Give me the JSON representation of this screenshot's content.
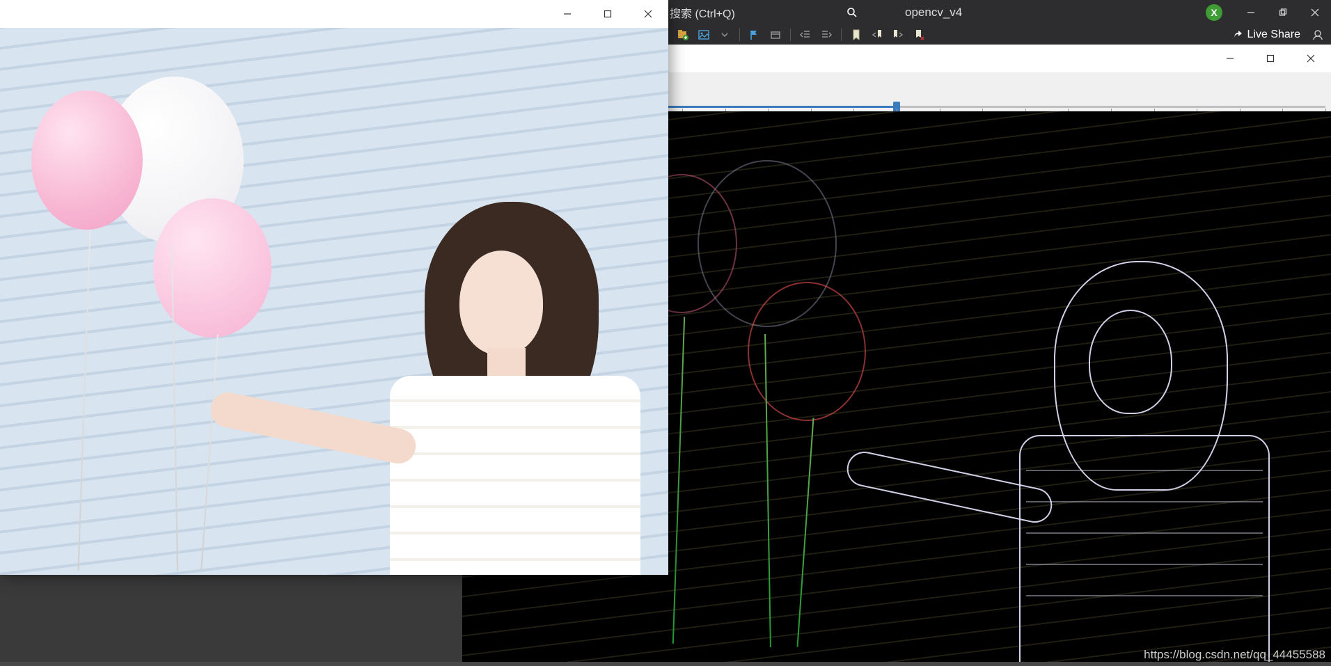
{
  "vs": {
    "search_hint": "搜索 (Ctrl+Q)",
    "tab": "opencv_v4",
    "badge": "X",
    "live_share": "Live Share"
  },
  "trackbar": {
    "value": 50,
    "max": 100
  },
  "watermark": "https://blog.csdn.net/qq_44455588"
}
